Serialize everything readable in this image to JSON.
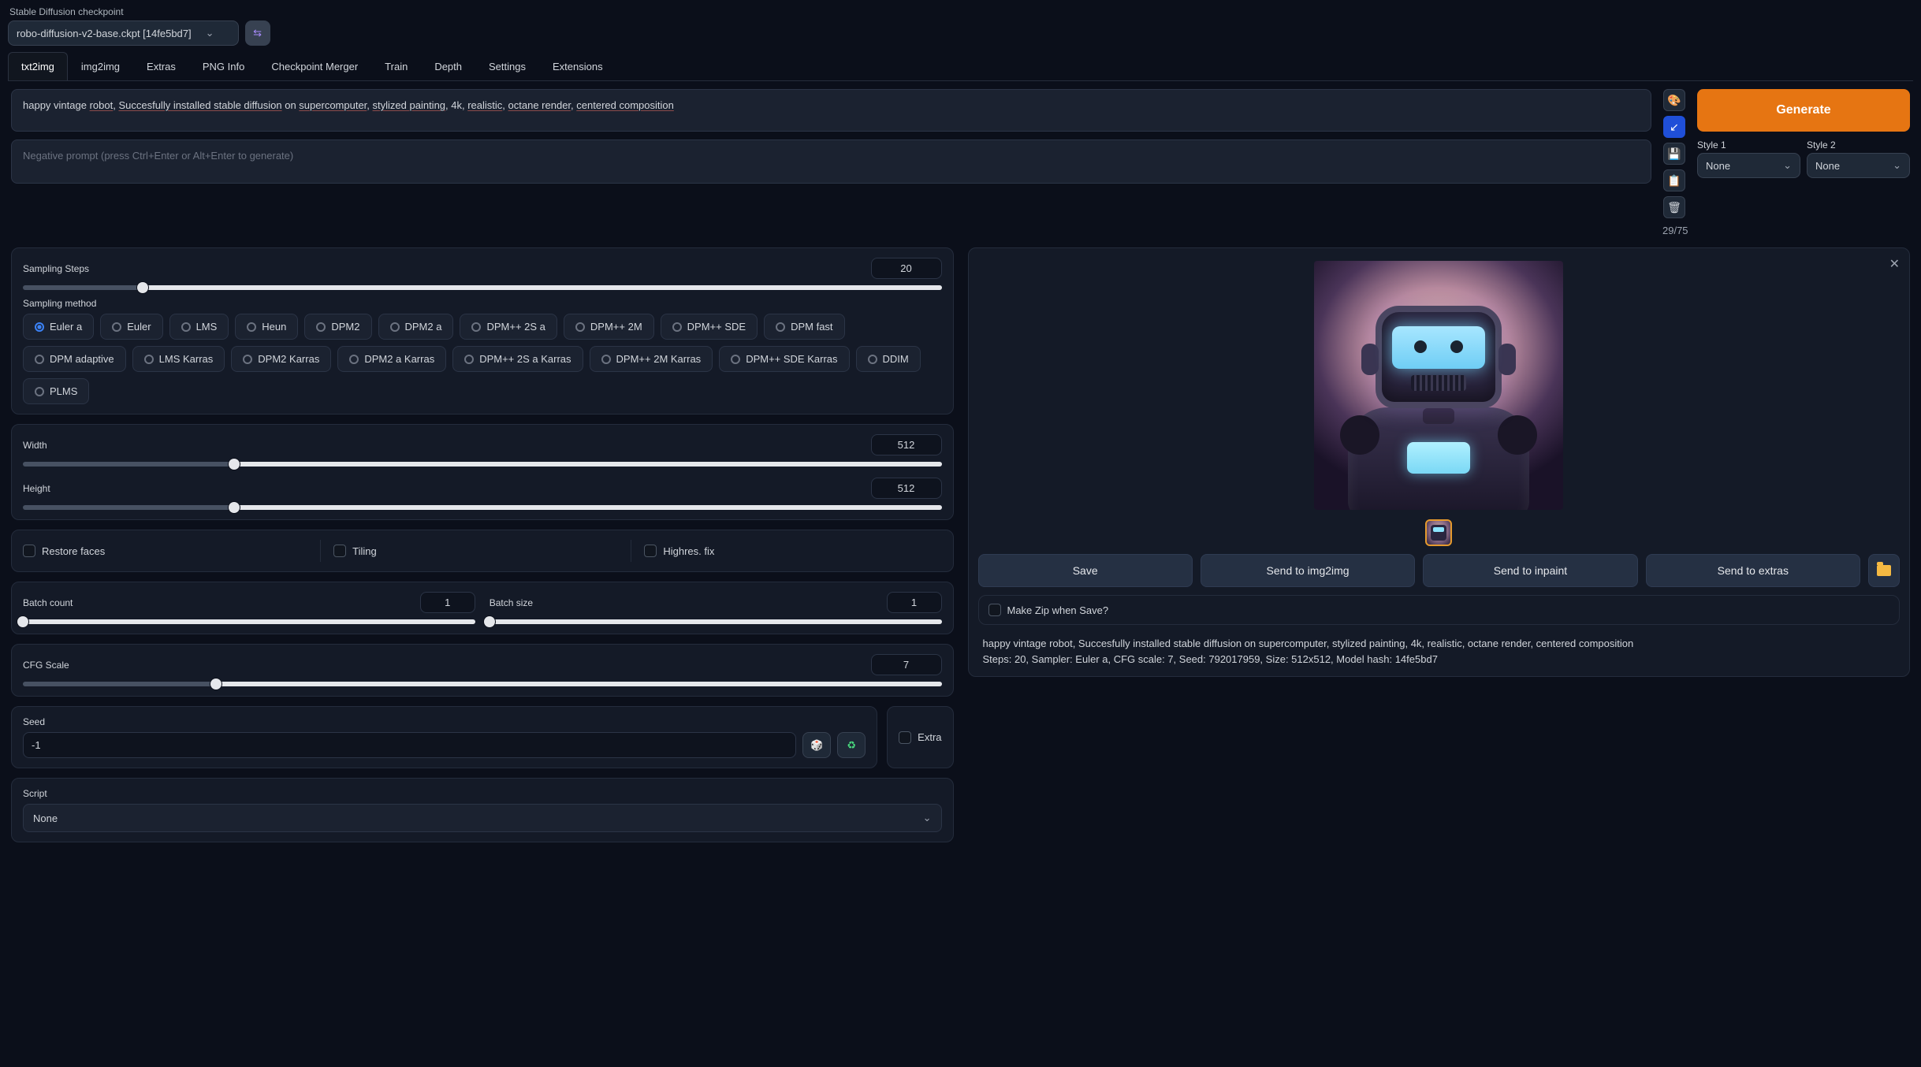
{
  "checkpoint": {
    "label": "Stable Diffusion checkpoint",
    "value": "robo-diffusion-v2-base.ckpt [14fe5bd7]"
  },
  "tabs": [
    "txt2img",
    "img2img",
    "Extras",
    "PNG Info",
    "Checkpoint Merger",
    "Train",
    "Depth",
    "Settings",
    "Extensions"
  ],
  "active_tab": "txt2img",
  "prompt": {
    "full": "happy vintage robot, Succesfully installed stable diffusion on supercomputer, stylized painting, 4k, realistic, octane render, centered composition",
    "p0": "happy vintage ",
    "p1": "robot",
    "p2": ", ",
    "p3": "Succesfully installed stable diffusion",
    "p4": " on ",
    "p5": "supercomputer",
    "p6": ", ",
    "p7": "stylized painting",
    "p8": ", 4k, ",
    "p9": "realistic",
    "p10": ", ",
    "p11": "octane render",
    "p12": ", ",
    "p13": "centered composition"
  },
  "neg_placeholder": "Negative prompt (press Ctrl+Enter or Alt+Enter to generate)",
  "token_counter": "29/75",
  "generate_label": "Generate",
  "style1": {
    "label": "Style 1",
    "value": "None"
  },
  "style2": {
    "label": "Style 2",
    "value": "None"
  },
  "sampling_steps": {
    "label": "Sampling Steps",
    "value": "20"
  },
  "sampling_method": {
    "label": "Sampling method",
    "options": [
      "Euler a",
      "Euler",
      "LMS",
      "Heun",
      "DPM2",
      "DPM2 a",
      "DPM++ 2S a",
      "DPM++ 2M",
      "DPM++ SDE",
      "DPM fast",
      "DPM adaptive",
      "LMS Karras",
      "DPM2 Karras",
      "DPM2 a Karras",
      "DPM++ 2S a Karras",
      "DPM++ 2M Karras",
      "DPM++ SDE Karras",
      "DDIM",
      "PLMS"
    ],
    "selected": "Euler a"
  },
  "width": {
    "label": "Width",
    "value": "512"
  },
  "height": {
    "label": "Height",
    "value": "512"
  },
  "restore_faces": "Restore faces",
  "tiling": "Tiling",
  "highres_fix": "Highres. fix",
  "batch_count": {
    "label": "Batch count",
    "value": "1"
  },
  "batch_size": {
    "label": "Batch size",
    "value": "1"
  },
  "cfg": {
    "label": "CFG Scale",
    "value": "7"
  },
  "seed": {
    "label": "Seed",
    "value": "-1",
    "extra": "Extra"
  },
  "script": {
    "label": "Script",
    "value": "None"
  },
  "actions": {
    "save": "Save",
    "img2img": "Send to img2img",
    "inpaint": "Send to inpaint",
    "extras": "Send to extras"
  },
  "zip_label": "Make Zip when Save?",
  "meta_line1": "happy vintage robot, Succesfully installed stable diffusion on supercomputer, stylized painting, 4k, realistic, octane render, centered composition",
  "meta_line2": "Steps: 20, Sampler: Euler a, CFG scale: 7, Seed: 792017959, Size: 512x512, Model hash: 14fe5bd7"
}
